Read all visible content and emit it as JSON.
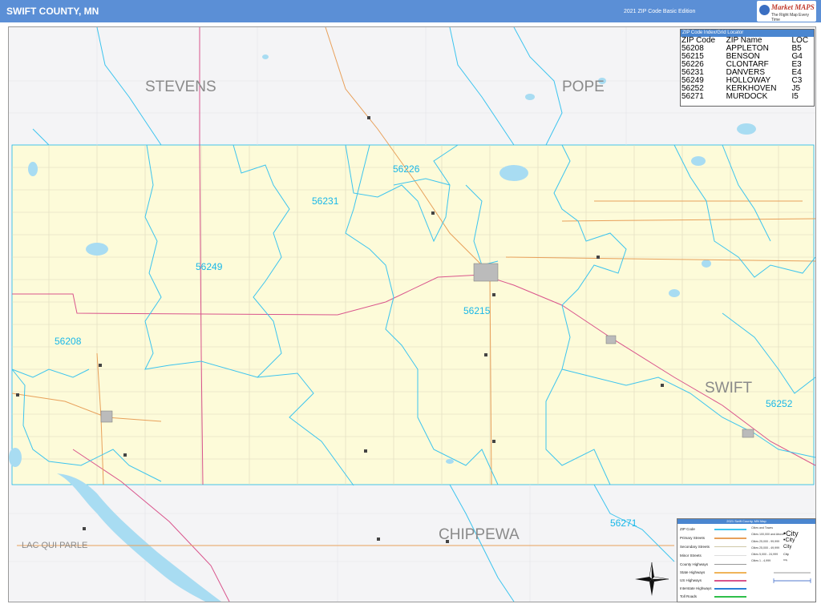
{
  "header": {
    "title": "SWIFT COUNTY, MN",
    "edition": "2021 ZIP Code Basic Edition",
    "logo_text": "Market MAPS",
    "logo_sub": "The Right Map Every Time"
  },
  "counties": {
    "stevens": "STEVENS",
    "pope": "POPE",
    "swift": "SWIFT",
    "chippewa": "CHIPPEWA",
    "lac_qui_parle": "LAC QUI PARLE"
  },
  "zips": {
    "z56226": "56226",
    "z56231": "56231",
    "z56249": "56249",
    "z56208": "56208",
    "z56215": "56215",
    "z56252": "56252",
    "z56271": "56271"
  },
  "zip_index": {
    "heading": "ZIP Code Index/Grid Locator",
    "col_zip": "ZIP Code",
    "col_name": "ZIP Name",
    "col_loc": "LOC",
    "rows": [
      {
        "zip": "56208",
        "name": "APPLETON",
        "loc": "B5"
      },
      {
        "zip": "56215",
        "name": "BENSON",
        "loc": "G4"
      },
      {
        "zip": "56226",
        "name": "CLONTARF",
        "loc": "E3"
      },
      {
        "zip": "56231",
        "name": "DANVERS",
        "loc": "E4"
      },
      {
        "zip": "56249",
        "name": "HOLLOWAY",
        "loc": "C3"
      },
      {
        "zip": "56252",
        "name": "KERKHOVEN",
        "loc": "J5"
      },
      {
        "zip": "56271",
        "name": "MURDOCK",
        "loc": "I5"
      }
    ]
  },
  "legend": {
    "heading": "2021 Swift County, MN Map",
    "rows": {
      "zip_code": "ZIP Code",
      "primary": "Primary Streets",
      "secondary": "Secondary Streets",
      "minor": "Minor Streets",
      "county_hwy": "County Highways",
      "state_hwy": "State Highways",
      "us_hwy": "US Highways",
      "interstate": "Interstate Highways",
      "toll": "Toll Roads"
    },
    "cities_heading": "Cities and Towns",
    "city_classes": {
      "c1": "Cities 100,000 and Above",
      "c2": "Cities 25,000 - 99,999",
      "c3": "Cities 25,000 - 49,999",
      "c4": "Cities 5,000 - 24,999",
      "c5": "Cities 1 - 4,999"
    },
    "city_samples": {
      "s1": "•City",
      "s2": "•City",
      "s3": "City",
      "s4": "City",
      "s5": "City"
    }
  },
  "colors": {
    "header_bg": "#5b8fd6",
    "zip_line": "#3cc4ee",
    "county_fill": "#fdfbd9",
    "water": "#a8dcf2",
    "road_orange": "#e8a05a",
    "road_pink": "#d9548c",
    "grid": "#d7d3b8"
  }
}
